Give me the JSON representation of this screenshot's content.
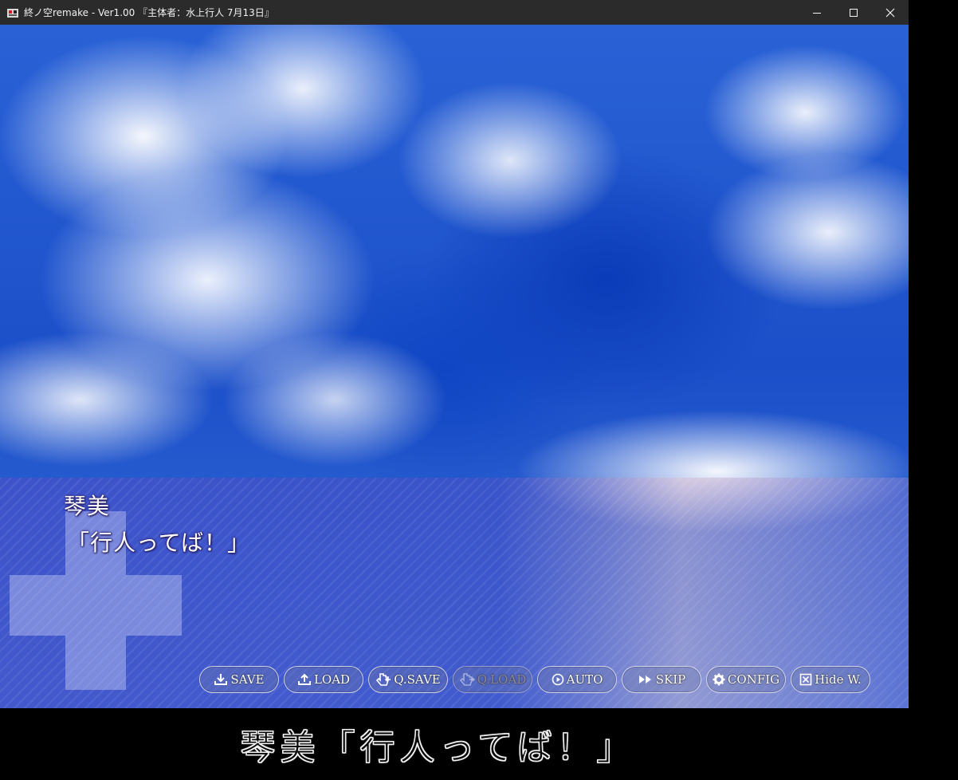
{
  "window": {
    "title": "終ノ空remake - Ver1.00 『主体者：水上行人 7月13日』",
    "controls": {
      "minimize_icon": "minimize-icon",
      "maximize_icon": "maximize-icon",
      "close_icon": "close-icon"
    }
  },
  "scene": {
    "background": "sky-with-clouds"
  },
  "textbox": {
    "speaker": "琴美",
    "dialogue": "「行人ってば！」"
  },
  "menu": {
    "buttons": [
      {
        "label": "SAVE",
        "icon": "download-icon",
        "enabled": true
      },
      {
        "label": "LOAD",
        "icon": "upload-icon",
        "enabled": true
      },
      {
        "label": "Q.SAVE",
        "icon": "hand-pointer-icon",
        "enabled": true
      },
      {
        "label": "Q.LOAD",
        "icon": "hand-pointer-icon",
        "enabled": false
      },
      {
        "label": "AUTO",
        "icon": "play-circle-icon",
        "enabled": true
      },
      {
        "label": "SKIP",
        "icon": "fast-forward-icon",
        "enabled": true
      },
      {
        "label": "CONFIG",
        "icon": "gear-icon",
        "enabled": true
      },
      {
        "label": "Hide W.",
        "icon": "close-box-icon",
        "enabled": true
      }
    ]
  },
  "subtitle": "琴美「行人ってば！」",
  "colors": {
    "titlebar": "#2b2b2b",
    "textbox_tint": "#4650c8",
    "text_outline": "#2a1f6a"
  }
}
